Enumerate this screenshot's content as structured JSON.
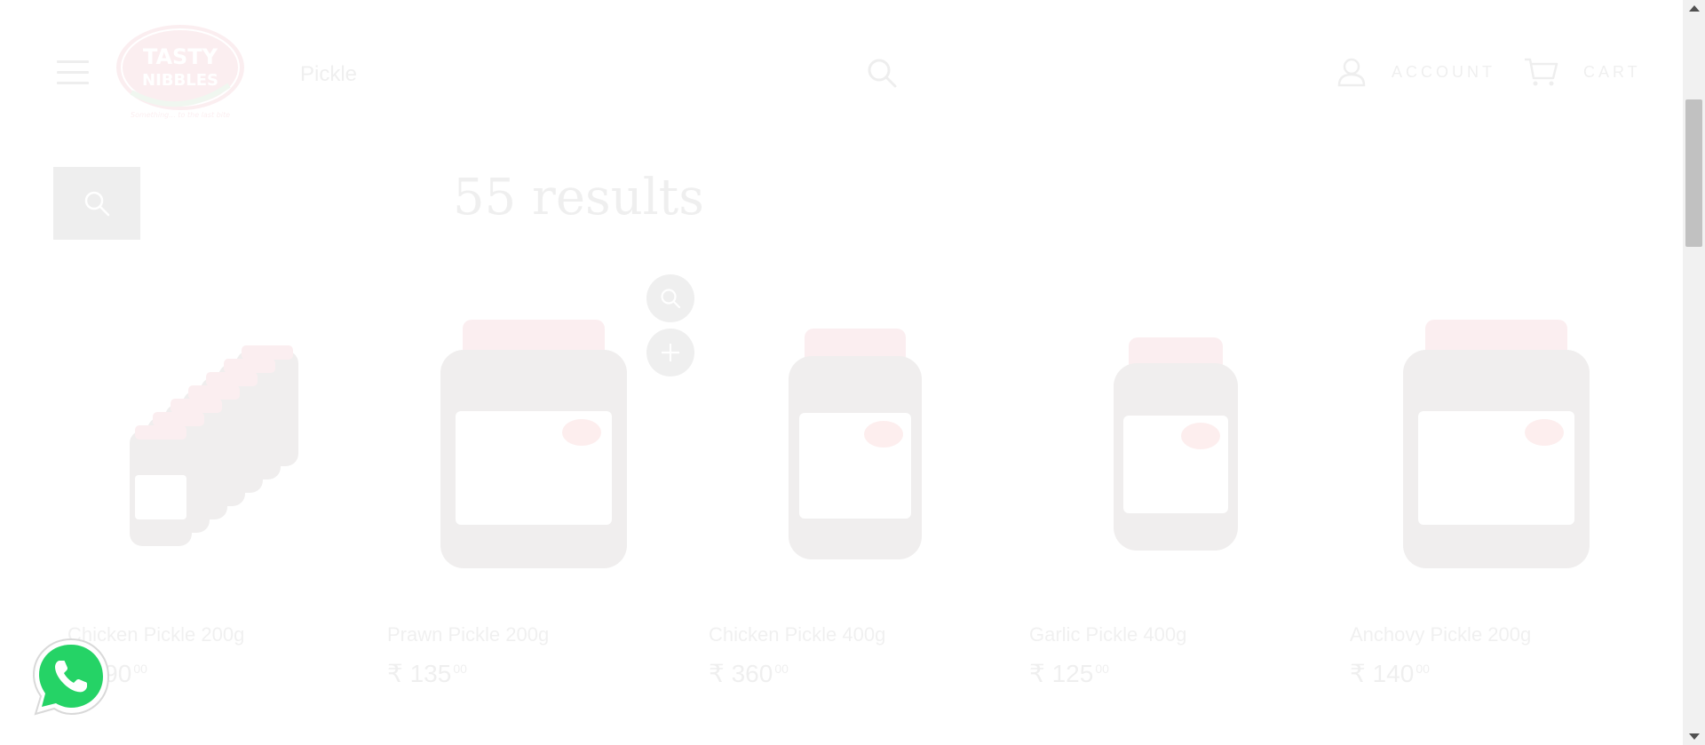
{
  "header": {
    "logo_text_1": "TASTY",
    "logo_text_2": "NIBBLES",
    "logo_tagline": "Something... to the last bite",
    "search_value": "Pickle",
    "account_label": "ACCOUNT",
    "cart_label": "CART"
  },
  "results": {
    "title": "55 results"
  },
  "products": [
    {
      "name": "Chicken Pickle 200g",
      "currency": "₹",
      "price": "190",
      "cents": "00",
      "label": "Chicken"
    },
    {
      "name": "Prawn Pickle 200g",
      "currency": "₹",
      "price": "135",
      "cents": "00",
      "label": "Prawn"
    },
    {
      "name": "Chicken Pickle 400g",
      "currency": "₹",
      "price": "360",
      "cents": "00",
      "label": "Chicken"
    },
    {
      "name": "Garlic Pickle 400g",
      "currency": "₹",
      "price": "125",
      "cents": "00",
      "label": "Garlic"
    },
    {
      "name": "Anchovy Pickle 200g",
      "currency": "₹",
      "price": "140",
      "cents": "00",
      "label": "Anchovy"
    }
  ],
  "colors": {
    "brand_red": "#c8102e",
    "overlay": "rgba(255,255,255,0.93)",
    "whatsapp_green": "#25d366"
  },
  "icons": {
    "menu": "hamburger-icon",
    "search": "search-icon",
    "account": "user-icon",
    "cart": "cart-icon",
    "quick_view": "zoom-icon",
    "quick_add": "plus-icon",
    "whatsapp": "whatsapp-icon"
  }
}
